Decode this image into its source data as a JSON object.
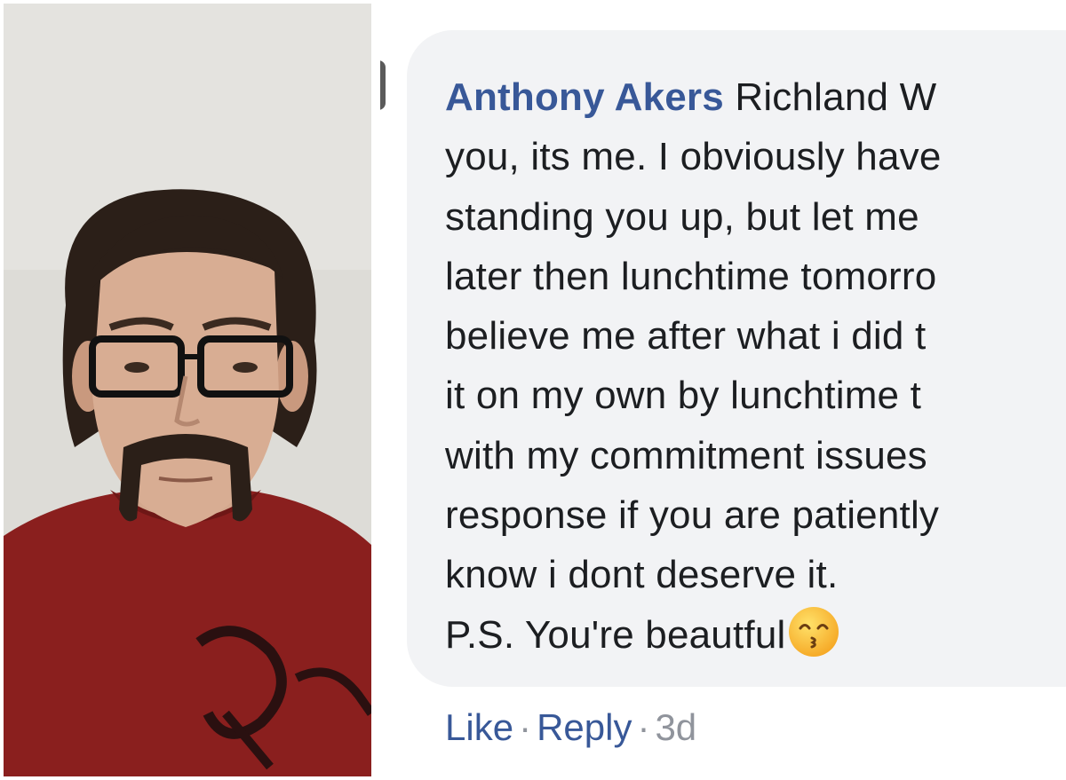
{
  "photo": {
    "subject": "mugshot-photo"
  },
  "comment": {
    "author": "Anthony Akers",
    "lines": [
      "Richland W",
      "you, its me. I obviously have",
      "standing you up, but let me",
      "later then lunchtime tomorro",
      "believe me after what i did t",
      "it on my own by lunchtime t",
      "with my commitment issues",
      "response if you are patiently",
      "know i dont deserve it.",
      "P.S. You're beautful"
    ],
    "emoji_icon": "kissing-smiling-eyes-emoji"
  },
  "actions": {
    "like_label": "Like",
    "separator": "·",
    "reply_label": "Reply",
    "time": "3d"
  },
  "colors": {
    "author": "#385898",
    "bubble": "#f2f3f5",
    "text": "#1c1e21",
    "meta": "#90949c"
  }
}
